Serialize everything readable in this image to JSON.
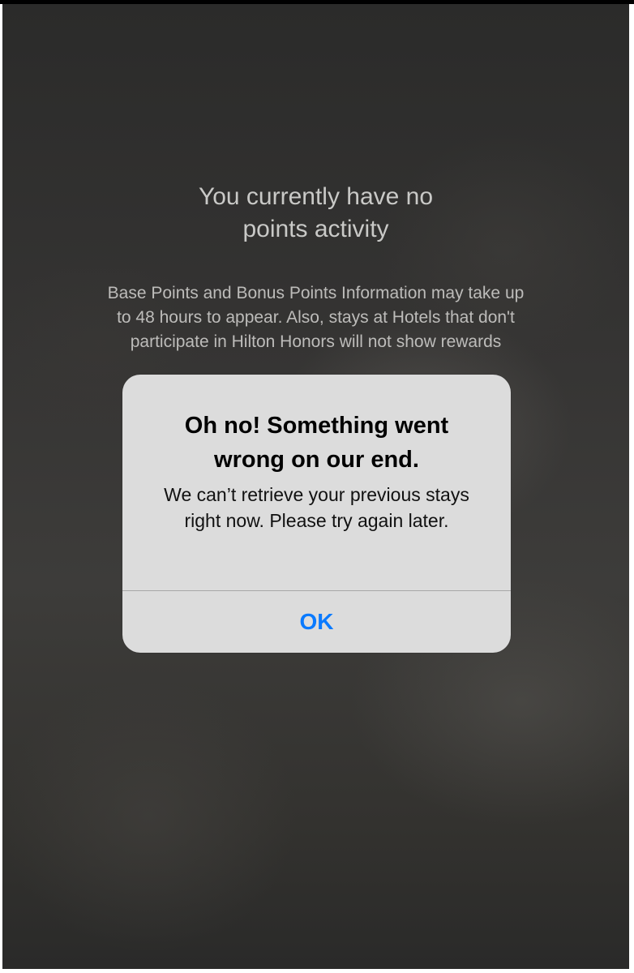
{
  "background": {
    "heading": "You currently have no points activity",
    "info": "Base Points and Bonus Points Information may take up to 48 hours to appear. Also, stays at Hotels that don't participate in Hilton Honors will not show rewards"
  },
  "alert": {
    "title": "Oh no! Something went wrong on our end.",
    "message": "We can’t retrieve your previous stays right now. Please try again later.",
    "ok_label": "OK"
  },
  "colors": {
    "accent": "#0a7aff",
    "alert_background": "#dcdcdc"
  }
}
